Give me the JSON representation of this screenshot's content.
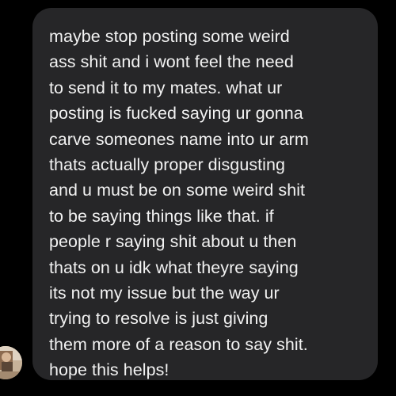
{
  "chat": {
    "incoming_message": {
      "sender_avatar_icon": "person-avatar-icon",
      "bubble_color": "#262628",
      "text_color": "#f2f2f2",
      "lines": [
        "maybe stop posting some weird",
        "ass shit and i wont feel the need",
        "to send it to my mates. what ur",
        "posting is fucked saying ur gonna",
        "carve someones name into ur arm",
        "thats actually proper disgusting",
        "and u must be on some weird shit",
        "to be saying things like that. if",
        "people r saying shit about u then",
        "thats on u idk what theyre saying",
        "its not my issue but the way ur",
        "trying to resolve is just giving",
        "them more of a reason to say shit.",
        "hope this helps!"
      ]
    }
  }
}
